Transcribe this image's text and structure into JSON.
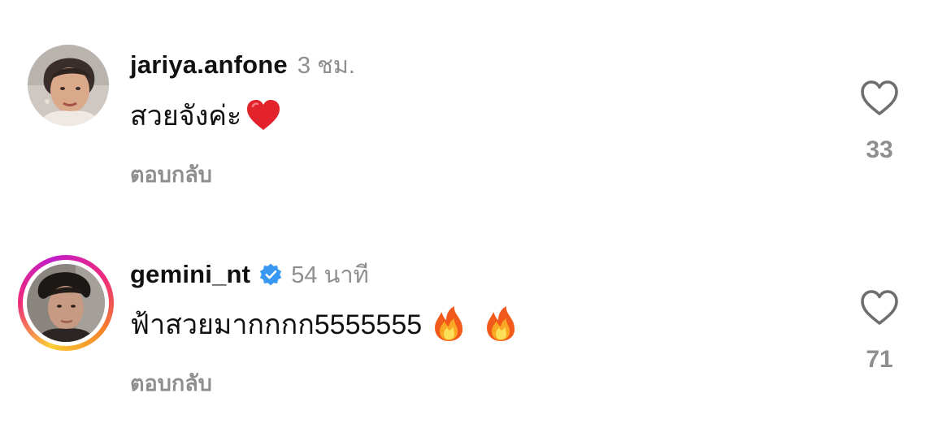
{
  "comments": [
    {
      "username": "jariya.anfone",
      "verified": false,
      "timestamp": "3 ชม.",
      "text": "สวยจังค่ะ",
      "emojis": [
        "red-heart-emoji"
      ],
      "reply_label": "ตอบกลับ",
      "like_count": "33",
      "has_story_ring": false
    },
    {
      "username": "gemini_nt",
      "verified": true,
      "timestamp": "54 นาที",
      "text": "ฟ้าสวยมากกกก5555555",
      "emojis": [
        "fire-emoji",
        "fire-emoji"
      ],
      "reply_label": "ตอบกลับ",
      "like_count": "71",
      "has_story_ring": true
    }
  ],
  "icons": {
    "like": "heart-outline-icon",
    "verified": "verified-badge-icon"
  },
  "colors": {
    "verified_blue": "#3897f0",
    "secondary_text": "#8e8e8e",
    "primary_text": "#111111"
  }
}
